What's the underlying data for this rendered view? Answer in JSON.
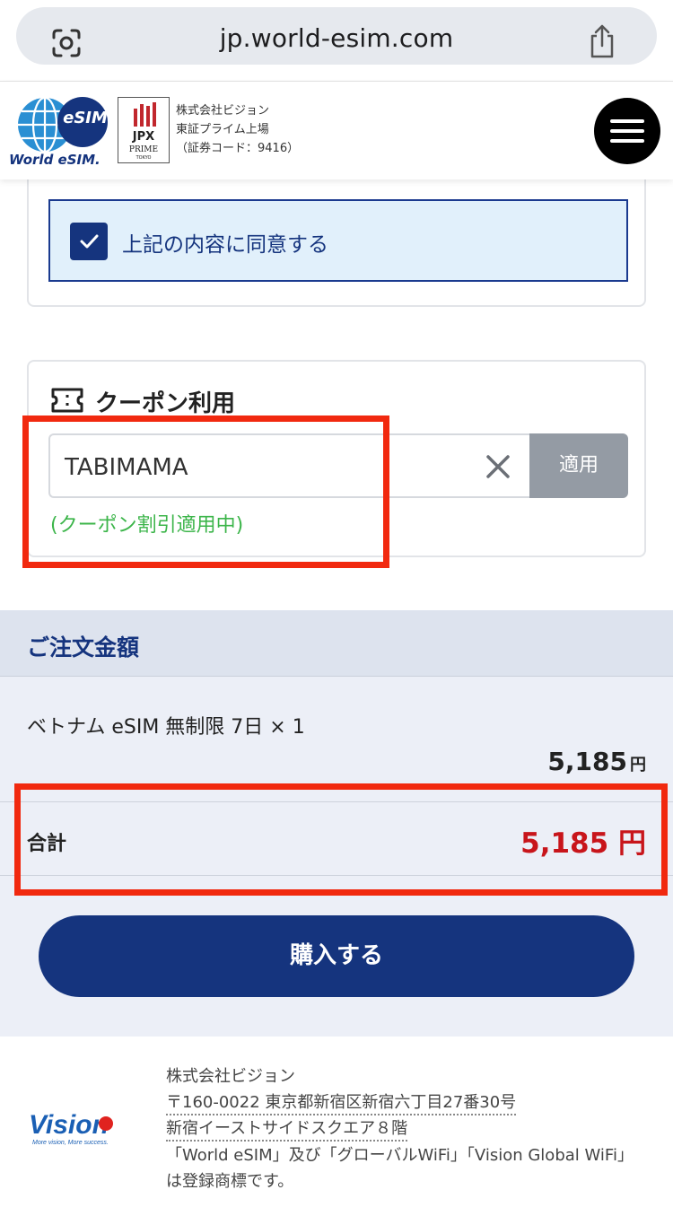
{
  "browser": {
    "url": "jp.world-esim.com",
    "lens_icon": "camera-search-icon",
    "share_icon": "share-icon"
  },
  "header": {
    "logo_text": "World eSIM.",
    "logo_badge": "eSIM",
    "jpx_label": "JPX",
    "jpx_prime": "PRIME",
    "jpx_city": "TOKYO",
    "company_name": "株式会社ビジョン",
    "listing": "東証プライム上場",
    "securities_code": "（証券コード：9416）",
    "menu_icon": "hamburger-menu-icon"
  },
  "agreement": {
    "label": "上記の内容に同意する",
    "checked": true
  },
  "coupon": {
    "title": "クーポン利用",
    "input_value": "TABIMAMA",
    "apply_label": "適用",
    "status": "(クーポン割引適用中)",
    "colors": {
      "status": "#3cb54a",
      "apply_bg": "#949ba4"
    }
  },
  "order": {
    "title": "ご注文金額",
    "items": [
      {
        "name": "ベトナム eSIM 無制限 7日 × 1",
        "price": "5,185",
        "unit": "円"
      }
    ],
    "total_label": "合計",
    "total_amount": "5,185 円",
    "buy_label": "購入する",
    "colors": {
      "accent": "#15347e",
      "total": "#c8151b"
    }
  },
  "footer": {
    "logo_text": "Vision",
    "logo_tagline": "More vision, More success.",
    "company": "株式会社ビジョン",
    "address": "〒160-0022 東京都新宿区新宿六丁目27番30号",
    "building": "新宿イーストサイドスクエア８階",
    "trademark": "「World eSIM」及び「グローバルWiFi」「Vision Global WiFi」は登録商標です。"
  },
  "highlight_color": "#f1290f"
}
